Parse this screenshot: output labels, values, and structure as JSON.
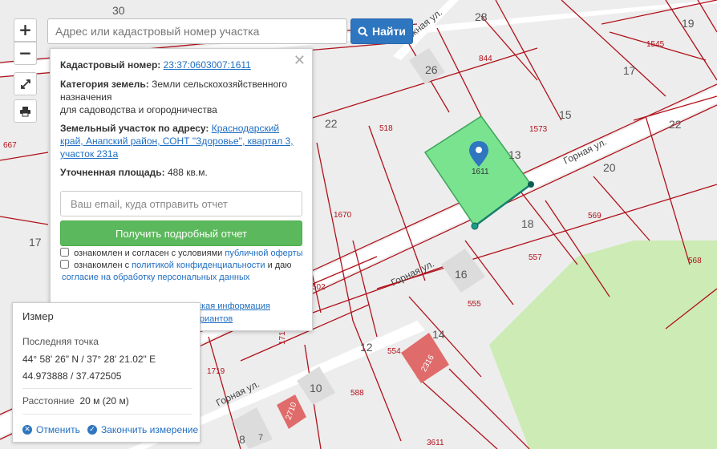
{
  "search": {
    "placeholder": "Адрес или кадастровый номер участка",
    "button_label": "Найти"
  },
  "controls": {
    "zoom_in": "+",
    "zoom_out": "−"
  },
  "popup": {
    "cadastral_label": "Кадастровый номер:",
    "cadastral_value": "23:37:0603007:1611",
    "category_label": "Категория земель:",
    "category_value": "Земли сельскохозяйственного назначения",
    "category_value_2": "для садоводства и огородничества",
    "address_label": "Земельный участок по адресу:",
    "address_value": "Краснодарский край, Анапский район, СОНТ \"Здоровье\", квартал 3, участок 231а",
    "area_label": "Уточненная площадь:",
    "area_value": "488 кв.м.",
    "email_placeholder": "Ваш email, куда отправить отчет",
    "report_button": "Получить подробный отчет",
    "consent1_text": "ознакомлен и согласен с условиями",
    "consent1_link": "публичной оферты",
    "consent2_text": "ознакомлен с",
    "consent2_link": "политикой конфиденциальности",
    "consent2_text2": "и даю",
    "consent2_link2": "согласие на обработку персональных данных",
    "details_link": "Детали отчета и юридическая информация",
    "manual_link": "Ручной выбор вариантов"
  },
  "measure": {
    "title": "Измер",
    "last_point_label": "Последняя точка",
    "coords_dms": "44° 58' 26\" N / 37° 28' 21.02\" E",
    "coords_dec": "44.973888 / 37.472505",
    "distance_label": "Расстояние",
    "distance_value": "20 м (20 м)",
    "cancel": "Отменить",
    "finish": "Закончить измерение"
  },
  "map": {
    "selected_parcel_label": "1611",
    "street_labels": [
      "Горная ул.",
      "Горная ул.",
      "Горная ул.",
      "жная ул."
    ],
    "block_numbers": [
      "30",
      "28",
      "26",
      "19",
      "17",
      "15",
      "13",
      "22",
      "22",
      "20",
      "18",
      "16",
      "14",
      "12",
      "10",
      "8",
      "7",
      "17"
    ],
    "parcel_numbers": [
      "844",
      "1545",
      "518",
      "1573",
      "1670",
      "569",
      "557",
      "568",
      "555",
      "554",
      "1719",
      "1719",
      "588",
      "3611",
      "502",
      "667",
      "2316",
      "2710"
    ],
    "colors": {
      "road": "#ffffff",
      "boundary": "#b0121b",
      "parcel_fill": "#79e38f",
      "greenery": "#ccebb5",
      "building": "#d8d8d8",
      "building_red": "#e06b6b"
    }
  }
}
